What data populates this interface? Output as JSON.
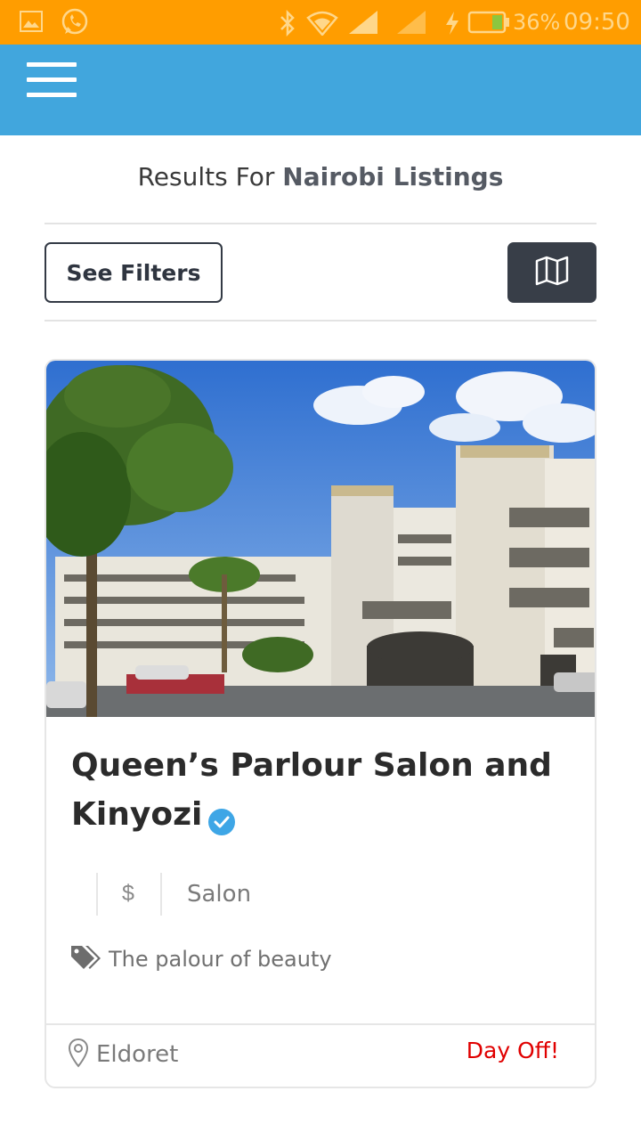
{
  "status_bar": {
    "battery": "36%",
    "time": "09:50",
    "icons": [
      "image-icon",
      "whatsapp-icon",
      "bluetooth-icon",
      "wifi-icon",
      "signal-icon",
      "signal-icon",
      "charging-icon",
      "battery-icon"
    ]
  },
  "header": {
    "menu_icon": "hamburger-menu-icon"
  },
  "results": {
    "prefix": "Results For",
    "query": "Nairobi Listings"
  },
  "toolbar": {
    "filters_label": "See Filters",
    "map_icon": "map-icon"
  },
  "listing": {
    "title": "Queen’s Parlour Salon and Kinyozi",
    "verified_icon": "verified-badge-icon",
    "price": "$",
    "category": "Salon",
    "tagline": "The palour of beauty",
    "location": "Eldoret",
    "status": "Day Off!"
  },
  "colors": {
    "status_bar": "#ff9d00",
    "app_bar": "#41a6dd",
    "dark_button": "#383e48",
    "status_red": "#e00000",
    "verified_blue": "#3ea6e6"
  }
}
